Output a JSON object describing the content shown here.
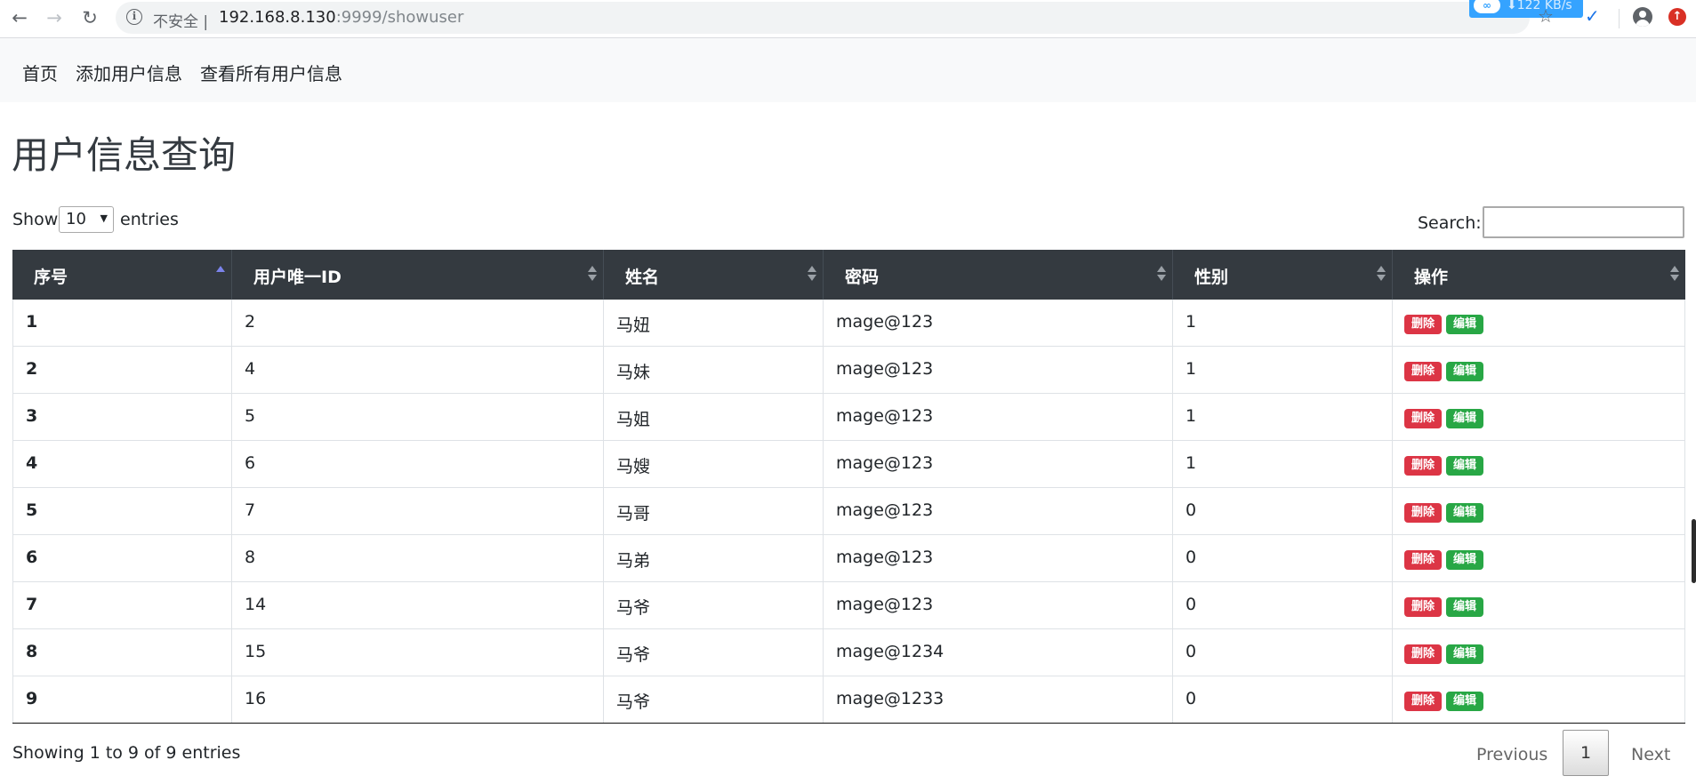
{
  "browser": {
    "security_label": "不安全 |",
    "url_host": "192.168.8.130",
    "url_rest": ":9999/showuser",
    "download_speed": "⬇122 KB/s"
  },
  "nav": {
    "items": [
      {
        "label": "首页"
      },
      {
        "label": "添加用户信息"
      },
      {
        "label": "查看所有用户信息"
      }
    ]
  },
  "page": {
    "title": "用户信息查询"
  },
  "table_controls": {
    "show_label": "Show",
    "page_size": "10",
    "entries_label": "entries",
    "search_label": "Search:",
    "search_value": ""
  },
  "table": {
    "columns": [
      "序号",
      "用户唯一ID",
      "姓名",
      "密码",
      "性别",
      "操作"
    ],
    "rows": [
      {
        "no": "1",
        "uid": "2",
        "name": "马妞",
        "password": "mage@123",
        "gender": "1"
      },
      {
        "no": "2",
        "uid": "4",
        "name": "马妹",
        "password": "mage@123",
        "gender": "1"
      },
      {
        "no": "3",
        "uid": "5",
        "name": "马姐",
        "password": "mage@123",
        "gender": "1"
      },
      {
        "no": "4",
        "uid": "6",
        "name": "马嫂",
        "password": "mage@123",
        "gender": "1"
      },
      {
        "no": "5",
        "uid": "7",
        "name": "马哥",
        "password": "mage@123",
        "gender": "0"
      },
      {
        "no": "6",
        "uid": "8",
        "name": "马弟",
        "password": "mage@123",
        "gender": "0"
      },
      {
        "no": "7",
        "uid": "14",
        "name": "马爷",
        "password": "mage@123",
        "gender": "0"
      },
      {
        "no": "8",
        "uid": "15",
        "name": "马爷",
        "password": "mage@1234",
        "gender": "0"
      },
      {
        "no": "9",
        "uid": "16",
        "name": "马爷",
        "password": "mage@1233",
        "gender": "0"
      }
    ],
    "delete_label": "删除",
    "edit_label": "编辑",
    "sorted_column": "序号",
    "sort_direction": "ascending"
  },
  "footer": {
    "info": "Showing 1 to 9 of 9 entries",
    "previous": "Previous",
    "current_page": "1",
    "next": "Next"
  },
  "colors": {
    "header_bg": "#343a40",
    "delete_badge": "#dc3545",
    "edit_badge": "#28a745",
    "navbar_bg": "#f8f9fa"
  }
}
